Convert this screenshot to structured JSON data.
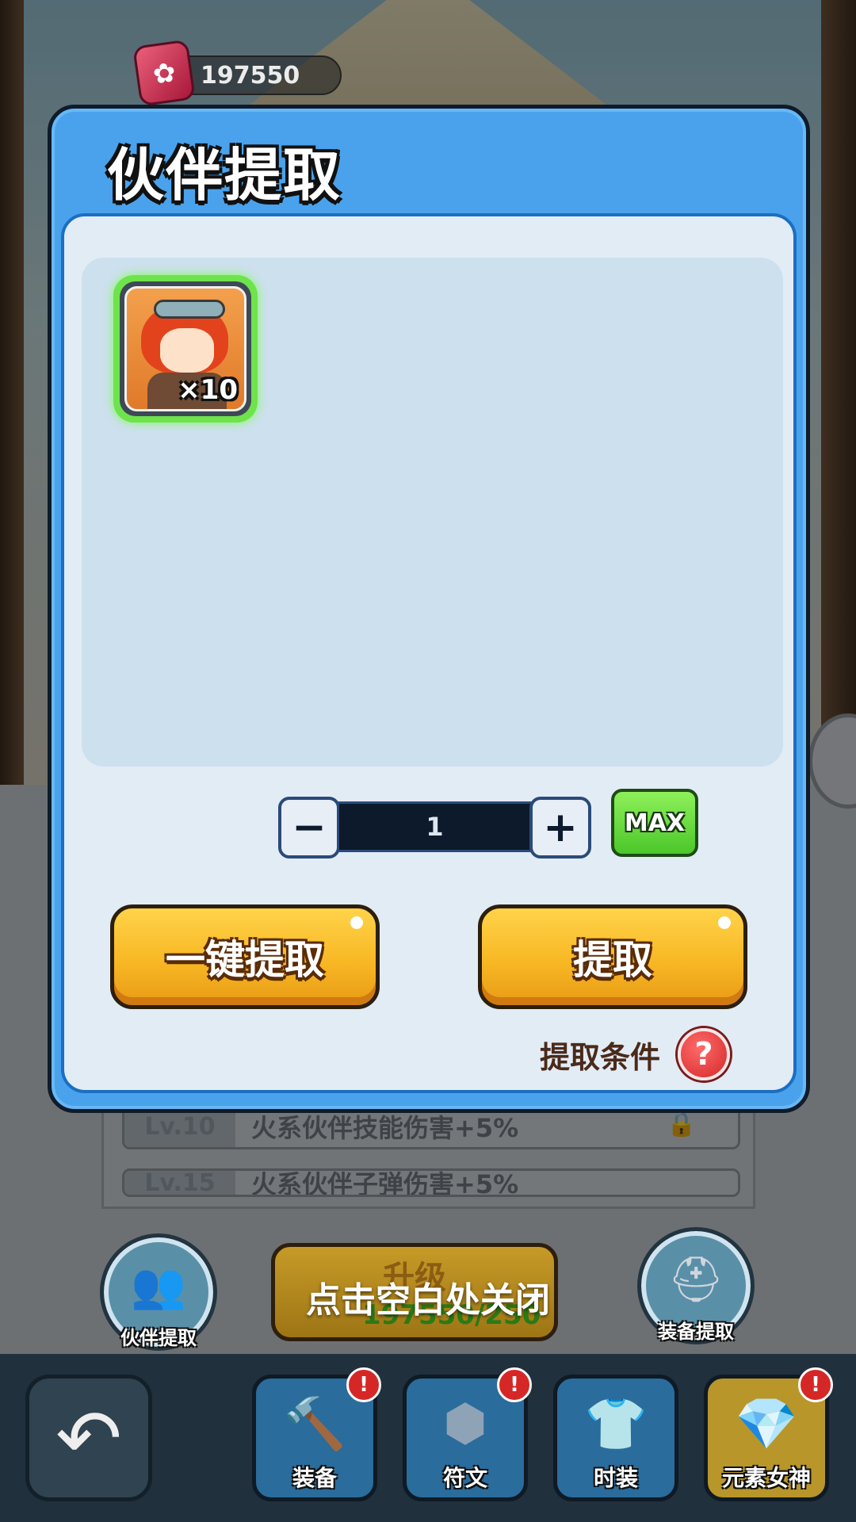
{
  "currency": {
    "icon": "gem-icon",
    "value": "197550"
  },
  "dialog": {
    "title": "伙伴提取",
    "items": [
      {
        "icon": "partner-portrait-icon",
        "count": "×10"
      }
    ],
    "quantity": {
      "minus": "−",
      "value": "1",
      "plus": "+"
    },
    "max_label": "MAX",
    "buttons": {
      "extract_all": "一键提取",
      "extract": "提取"
    },
    "conditions_label": "提取条件",
    "help": "?"
  },
  "background": {
    "levels": [
      {
        "tag": "Lv.10",
        "text": "火系伙伴技能伤害+5%"
      },
      {
        "tag": "Lv.15",
        "text": "火系伙伴子弹伤害+5%"
      }
    ],
    "partner_extract_label": "伙伴提取",
    "upgrade_label": "升级",
    "upgrade_cost": "197550/250",
    "equip_extract_label": "装备提取"
  },
  "close_hint": "点击空白处关闭",
  "nav": {
    "back": "↶",
    "tabs": [
      {
        "label": "装备",
        "icon": "hammer-icon",
        "alert": "!"
      },
      {
        "label": "符文",
        "icon": "rune-icon",
        "alert": "!"
      },
      {
        "label": "时装",
        "icon": "armor-icon",
        "alert": ""
      },
      {
        "label": "元素女神",
        "icon": "goddess-gem-icon",
        "alert": "!"
      }
    ]
  },
  "colors": {
    "dialog_blue": "#4aa2ec",
    "button_gold": "#f8b824",
    "max_green": "#6fd83d",
    "help_red": "#d42929"
  }
}
